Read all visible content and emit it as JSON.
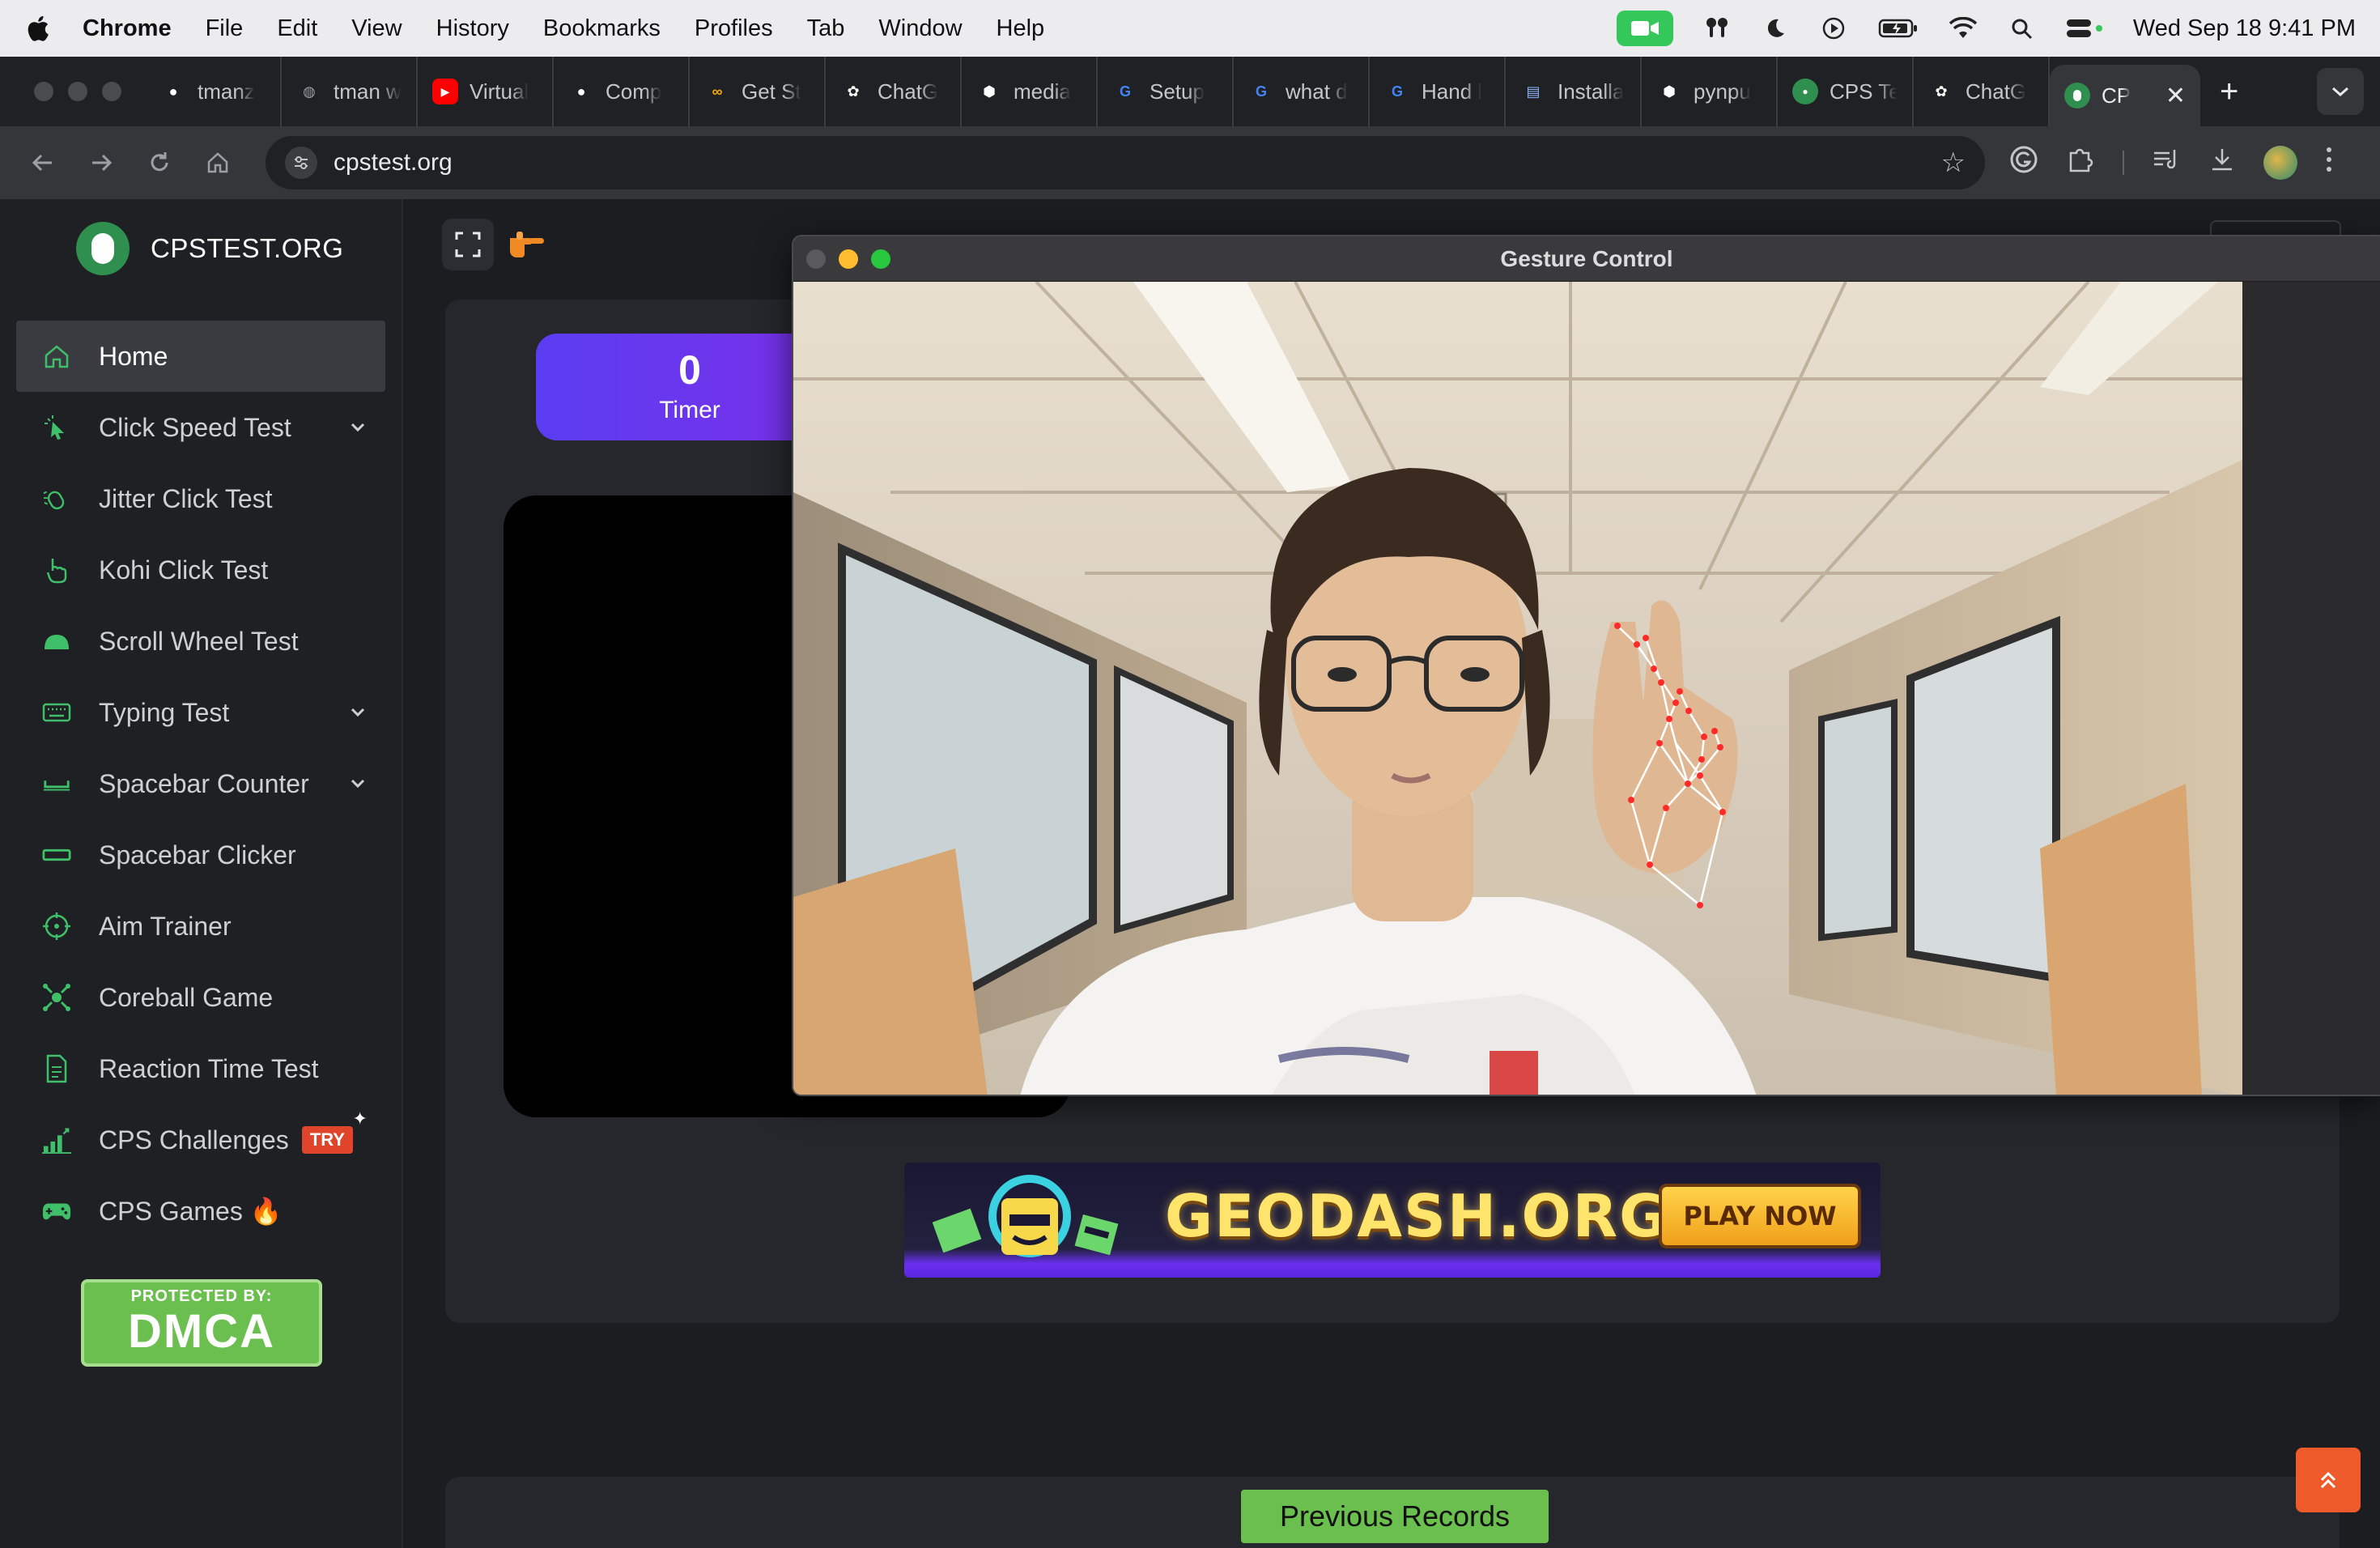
{
  "menubar": {
    "app": "Chrome",
    "items": [
      "File",
      "Edit",
      "View",
      "History",
      "Bookmarks",
      "Profiles",
      "Tab",
      "Window",
      "Help"
    ],
    "clock": "Wed Sep 18  9:41 PM"
  },
  "tabs": [
    {
      "label": "tmanz",
      "favicon": "github-icon",
      "color": "#ffffff"
    },
    {
      "label": "tman w",
      "favicon": "globe-icon",
      "color": "#9aa0a6"
    },
    {
      "label": "Virtual",
      "favicon": "youtube-icon",
      "color": "#ff0000"
    },
    {
      "label": "Comp",
      "favicon": "github-icon",
      "color": "#ffffff"
    },
    {
      "label": "Get St",
      "favicon": "colab-icon",
      "color": "#f9ab00"
    },
    {
      "label": "ChatG",
      "favicon": "openai-icon",
      "color": "#ffffff"
    },
    {
      "label": "media",
      "favicon": "cube-icon",
      "color": "#ffffff"
    },
    {
      "label": "Setup",
      "favicon": "google-icon",
      "color": "#4285f4"
    },
    {
      "label": "what d",
      "favicon": "google-icon",
      "color": "#4285f4"
    },
    {
      "label": "Hand l",
      "favicon": "google-icon",
      "color": "#4285f4"
    },
    {
      "label": "Installa",
      "favicon": "docs-icon",
      "color": "#8ab4f8"
    },
    {
      "label": "pynpu",
      "favicon": "cube-icon",
      "color": "#ffffff"
    },
    {
      "label": "CPS Te",
      "favicon": "cpstest-icon",
      "color": "#2f8f4e"
    },
    {
      "label": "ChatG",
      "favicon": "openai-icon",
      "color": "#ffffff"
    }
  ],
  "active_tab": {
    "label": "CP",
    "favicon": "cpstest-icon"
  },
  "address": "cpstest.org",
  "brand": "CPSTEST.ORG",
  "nav": [
    {
      "label": "Home",
      "icon": "home-icon",
      "active": true,
      "chevron": false
    },
    {
      "label": "Click Speed Test",
      "icon": "cursor-click-icon",
      "chevron": true
    },
    {
      "label": "Jitter Click Test",
      "icon": "jitter-mouse-icon",
      "chevron": false
    },
    {
      "label": "Kohi Click Test",
      "icon": "pointer-hand-icon",
      "chevron": false
    },
    {
      "label": "Scroll Wheel Test",
      "icon": "mouse-icon",
      "chevron": false
    },
    {
      "label": "Typing Test",
      "icon": "keyboard-icon",
      "chevron": true
    },
    {
      "label": "Spacebar Counter",
      "icon": "spacebar-icon",
      "chevron": true
    },
    {
      "label": "Spacebar Clicker",
      "icon": "rectangle-icon",
      "chevron": false
    },
    {
      "label": "Aim Trainer",
      "icon": "crosshair-icon",
      "chevron": false
    },
    {
      "label": "Coreball Game",
      "icon": "coreball-icon",
      "chevron": false
    },
    {
      "label": "Reaction Time Test",
      "icon": "document-icon",
      "chevron": false
    },
    {
      "label": "CPS Challenges",
      "icon": "bar-chart-icon",
      "chevron": false,
      "badge": "TRY"
    },
    {
      "label": "CPS Games 🔥",
      "icon": "gamepad-icon",
      "chevron": false
    }
  ],
  "dmca": {
    "top": "PROTECTED BY:",
    "main": "DMCA"
  },
  "timer": {
    "value": "0",
    "label": "Timer"
  },
  "ad": {
    "text": "GEODASH.ORG",
    "button": "PLAY NOW"
  },
  "records_button": "Previous Records",
  "gesture_window": {
    "title": "Gesture Control"
  },
  "colors": {
    "accent": "#3fbf6a",
    "timer": "#6a35f0",
    "records": "#6bbf4e",
    "scroll_top": "#ee5a2a"
  }
}
